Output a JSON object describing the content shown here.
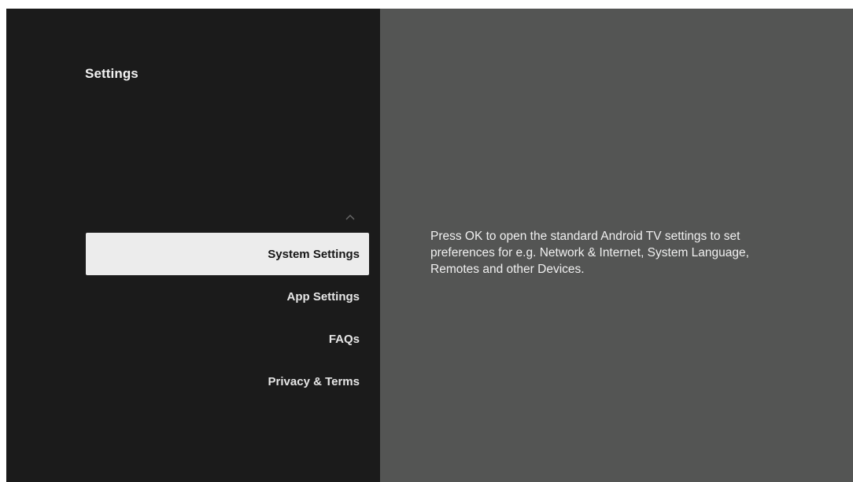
{
  "settings": {
    "title": "Settings",
    "scroll_up_icon": "chevron-up-icon",
    "menu": {
      "items": [
        {
          "label": "System Settings",
          "selected": true
        },
        {
          "label": "App Settings",
          "selected": false
        },
        {
          "label": "FAQs",
          "selected": false
        },
        {
          "label": "Privacy & Terms",
          "selected": false
        }
      ]
    },
    "description": "Press OK to open the standard Android TV settings to set preferences for e.g. Network & Internet, System Language, Remotes and other Devices."
  },
  "colors": {
    "left_panel": "#1b1b1b",
    "right_panel": "#545554",
    "selected_item_bg": "#ececec",
    "selected_item_text": "#161616",
    "text": "#ffffff"
  }
}
